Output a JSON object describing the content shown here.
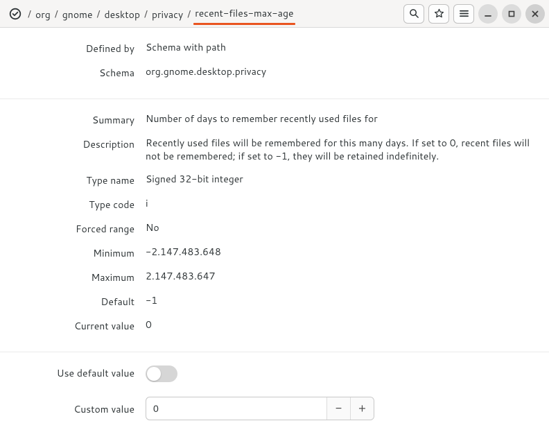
{
  "breadcrumb": {
    "segments": [
      "org",
      "gnome",
      "desktop",
      "privacy"
    ],
    "current": "recent-files-max-age"
  },
  "fields": {
    "defined_by": {
      "label": "Defined by",
      "value": "Schema with path"
    },
    "schema": {
      "label": "Schema",
      "value": "org.gnome.desktop.privacy"
    },
    "summary": {
      "label": "Summary",
      "value": "Number of days to remember recently used files for"
    },
    "description": {
      "label": "Description",
      "value": "Recently used files will be remembered for this many days. If set to 0, recent files will not be remembered; if set to -1, they will be retained indefinitely."
    },
    "type_name": {
      "label": "Type name",
      "value": "Signed 32-bit integer"
    },
    "type_code": {
      "label": "Type code",
      "value": "i"
    },
    "forced_range": {
      "label": "Forced range",
      "value": "No"
    },
    "minimum": {
      "label": "Minimum",
      "value": "-2.147.483.648"
    },
    "maximum": {
      "label": "Maximum",
      "value": "2.147.483.647"
    },
    "default": {
      "label": "Default",
      "value": "-1"
    },
    "current": {
      "label": "Current value",
      "value": "0"
    }
  },
  "controls": {
    "use_default_label": "Use default value",
    "custom_value_label": "Custom value",
    "custom_value": "0"
  }
}
